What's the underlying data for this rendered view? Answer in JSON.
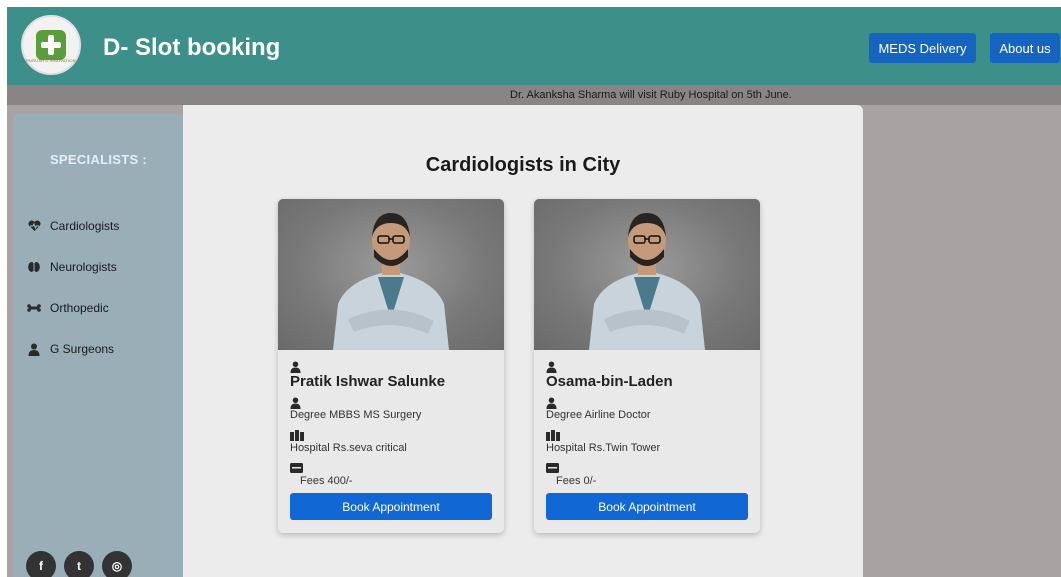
{
  "header": {
    "title": "D- Slot booking",
    "logo_text": "PURUSH'S INNOVATION",
    "nav": [
      {
        "label": "MEDS Delivery"
      },
      {
        "label": "About us"
      }
    ]
  },
  "announcement": "Dr. Akanksha Sharma will visit Ruby Hospital on 5th June.",
  "sidebar": {
    "title": "SPECIALISTS :",
    "items": [
      {
        "label": "Cardiologists",
        "icon": "heart-icon"
      },
      {
        "label": "Neurologists",
        "icon": "brain-icon"
      },
      {
        "label": "Orthopedic",
        "icon": "bone-icon"
      },
      {
        "label": "G Surgeons",
        "icon": "user-doctor-icon"
      }
    ],
    "social": [
      {
        "glyph": "f",
        "icon": "facebook-icon"
      },
      {
        "glyph": "t",
        "icon": "twitter-icon"
      },
      {
        "glyph": "◎",
        "icon": "instagram-icon"
      }
    ]
  },
  "main": {
    "title": "Cardiologists in City",
    "doctors": [
      {
        "name": "Pratik Ishwar Salunke",
        "degree": "Degree MBBS MS Surgery",
        "hospital": "Hospital Rs.seva critical",
        "fees": "Fees 400/-",
        "button": "Book Appointment"
      },
      {
        "name": "Osama-bin-Laden",
        "degree": "Degree Airline Doctor",
        "hospital": "Hospital Rs.Twin Tower",
        "fees": "Fees 0/-",
        "button": "Book Appointment"
      }
    ]
  },
  "colors": {
    "header": "#3d8f8a",
    "announce": "#8a8585",
    "sidebar": "#9aaeb8",
    "button": "#1167d4",
    "nav_button": "#1565c0"
  }
}
